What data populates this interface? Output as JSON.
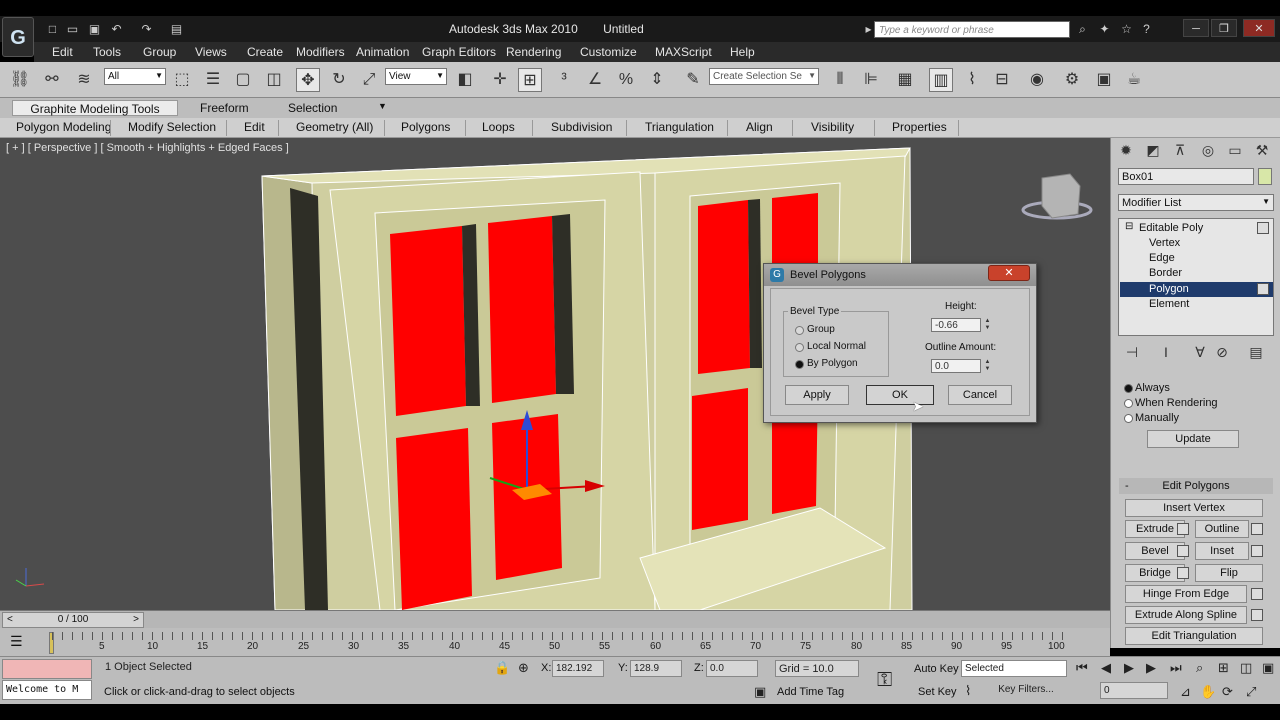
{
  "window": {
    "app_name": "Autodesk 3ds Max 2010",
    "file_name": "Untitled",
    "logo": "G",
    "search_placeholder": "Type a keyword or phrase",
    "minimize": "─",
    "restore": "❐",
    "close": "✕"
  },
  "menu": [
    "Edit",
    "Tools",
    "Group",
    "Views",
    "Create",
    "Modifiers",
    "Animation",
    "Graph Editors",
    "Rendering",
    "Customize",
    "MAXScript",
    "Help"
  ],
  "toolbar": {
    "selection_filter": "All",
    "reference_coord": "View",
    "named_selection_placeholder": "Create Selection Se"
  },
  "ribbon": {
    "tabs": [
      "Graphite Modeling Tools",
      "Freeform",
      "Selection"
    ],
    "panels": [
      "Polygon Modeling",
      "Modify Selection",
      "Edit",
      "Geometry (All)",
      "Polygons",
      "Loops",
      "Subdivision",
      "Triangulation",
      "Align",
      "Visibility",
      "Properties"
    ]
  },
  "viewport": {
    "label": "[ + ] [ Perspective ] [ Smooth + Highlights + Edged Faces ]"
  },
  "command_panel": {
    "object_name": "Box01",
    "object_color": "#d8e7a8",
    "modifier_list": "Modifier List",
    "stack": {
      "root": "Editable Poly",
      "items": [
        "Vertex",
        "Edge",
        "Border",
        "Polygon",
        "Element"
      ],
      "selected": "Polygon"
    },
    "update_options": [
      "Always",
      "When Rendering",
      "Manually"
    ],
    "update_button": "Update",
    "rollout_title": "Edit Polygons",
    "rollout_toggle": "-",
    "buttons": {
      "insert_vertex": "Insert Vertex",
      "extrude": "Extrude",
      "outline": "Outline",
      "bevel": "Bevel",
      "inset": "Inset",
      "bridge": "Bridge",
      "flip": "Flip",
      "hinge_from_edge": "Hinge From Edge",
      "extrude_along_spline": "Extrude Along Spline",
      "edit_triangulation": "Edit Triangulation"
    }
  },
  "dialog": {
    "title": "Bevel Polygons",
    "icon": "G",
    "close_glyph": "✕",
    "bevel_type_label": "Bevel Type",
    "options": [
      "Group",
      "Local Normal",
      "By Polygon"
    ],
    "selected_option": "By Polygon",
    "height_label": "Height:",
    "height_value": "-0.66",
    "outline_label": "Outline Amount:",
    "outline_value": "0.0",
    "apply": "Apply",
    "ok": "OK",
    "cancel": "Cancel"
  },
  "timeline": {
    "frame_display": "0 / 100",
    "prev_arrow": "<",
    "next_arrow": ">",
    "ticks": [
      "5",
      "10",
      "15",
      "20",
      "25",
      "30",
      "35",
      "40",
      "45",
      "50",
      "55",
      "60",
      "65",
      "70",
      "75",
      "80",
      "85",
      "90",
      "95",
      "100"
    ]
  },
  "status": {
    "maxscript_text": "Welcome to M",
    "selection_info": "1 Object Selected",
    "prompt": "Click or click-and-drag to select objects",
    "x_label": "X:",
    "x_value": "182.192",
    "y_label": "Y:",
    "y_value": "128.9",
    "z_label": "Z:",
    "z_value": "0.0",
    "grid": "Grid = 10.0",
    "add_time_tag": "Add Time Tag",
    "auto_key": "Auto Key",
    "set_key": "Set Key",
    "key_mode": "Selected",
    "key_filters": "Key Filters...",
    "current_frame": "0"
  },
  "colors": {
    "window_glass": "#d9252e",
    "frame_wood": "#d6d5a5",
    "viewport_bg": "#4d4d4d",
    "selection_blue": "#1f3b6c"
  }
}
